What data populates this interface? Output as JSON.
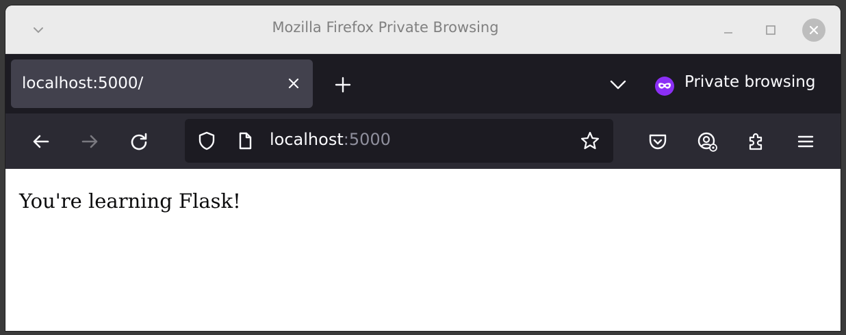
{
  "window": {
    "title": "Mozilla Firefox Private Browsing"
  },
  "tabs": [
    {
      "label": "localhost:5000/",
      "active": true
    }
  ],
  "tabstrip": {
    "private_label": "Private browsing"
  },
  "navbar": {
    "url_host": "localhost",
    "url_port": ":5000"
  },
  "page": {
    "text": "You're learning Flask!"
  },
  "colors": {
    "private_accent": "#8b2ff5",
    "toolbar_bg": "#2b2a33",
    "tabstrip_bg": "#1c1b22"
  },
  "icons": [
    "chevron-down-icon",
    "minimize-icon",
    "maximize-icon",
    "close-icon",
    "tab-close-icon",
    "plus-icon",
    "list-all-tabs-icon",
    "private-mask-icon",
    "back-arrow-icon",
    "forward-arrow-icon",
    "reload-icon",
    "shield-icon",
    "page-icon",
    "star-icon",
    "pocket-icon",
    "account-icon",
    "extensions-icon",
    "menu-icon"
  ]
}
